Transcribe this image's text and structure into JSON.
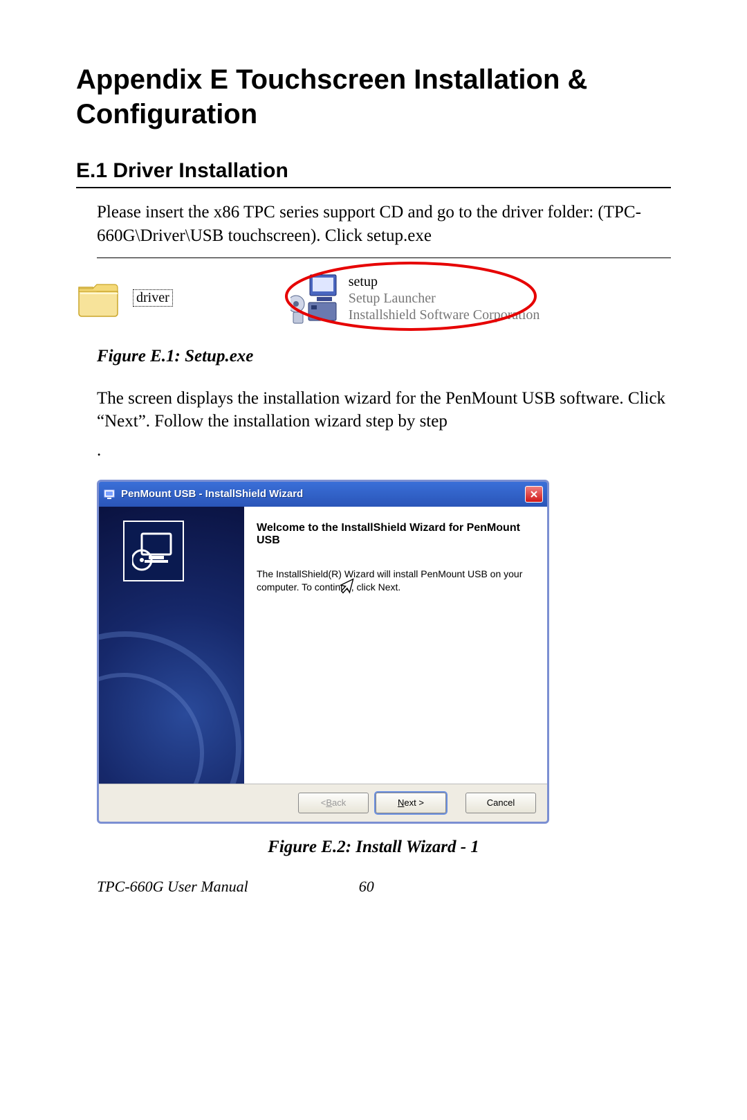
{
  "title": "Appendix E  Touchscreen Installation & Configuration",
  "section": "E.1  Driver Installation",
  "para1": "Please insert the x86 TPC series support CD and go to the driver folder: (TPC-660G\\Driver\\USB touchscreen).  Click setup.exe",
  "folder_label": "driver",
  "setup": {
    "line1": "setup",
    "line2": "Setup Launcher",
    "line3": "Installshield Software Corporation"
  },
  "fig1_caption": "Figure E.1: Setup.exe",
  "para2": "The screen displays the installation wizard for the PenMount USB software.  Click “Next”. Follow the installation wizard step by step",
  "wizard": {
    "title": "PenMount USB - InstallShield Wizard",
    "welcome": "Welcome to the InstallShield Wizard for PenMount USB",
    "desc": "The InstallShield(R) Wizard will install PenMount USB on your computer. To continue, click Next.",
    "back_prefix": "< ",
    "back_u": "B",
    "back_rest": "ack",
    "next_u": "N",
    "next_rest": "ext >",
    "cancel": "Cancel"
  },
  "fig2_caption": "Figure E.2: Install Wizard - 1",
  "footer_manual": "TPC-660G User Manual",
  "footer_page": "60"
}
